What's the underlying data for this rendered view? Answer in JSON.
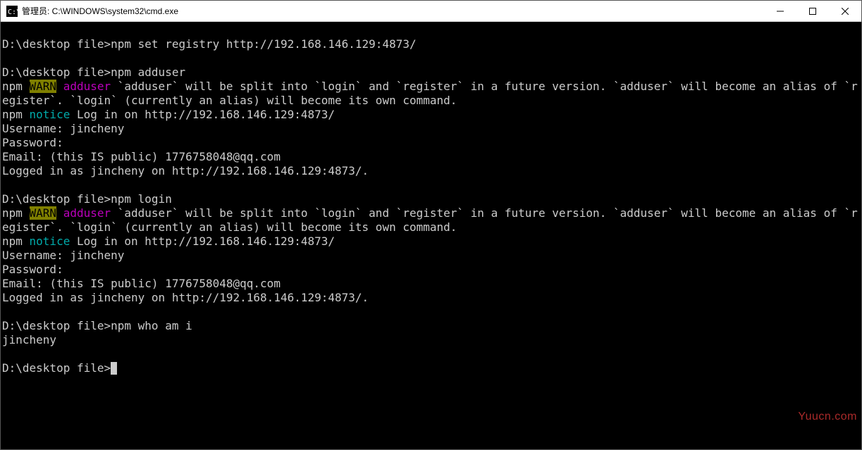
{
  "window": {
    "title": "管理员: C:\\WINDOWS\\system32\\cmd.exe"
  },
  "terminal": {
    "prompt": "D:\\desktop file>",
    "cmd_set_registry": "npm set registry http://192.168.146.129:4873/",
    "cmd_adduser": "npm adduser",
    "cmd_login": "npm login",
    "cmd_whoami": "npm who am i",
    "npm_label": "npm ",
    "warn_label": "WARN",
    "adduser_label": " adduser",
    "adduser_msg_line1": " `adduser` will be split into `login` and `register` in a future version. `adduser` will become an alias of `register`. `login` (currently an alias) will become its own command.",
    "notice_label": "notice",
    "login_url_line": " Log in on http://192.168.146.129:4873/",
    "username_line": "Username: jincheny",
    "password_line": "Password:",
    "email_line": "Email: (this IS public) 1776758048@qq.com",
    "logged_in_line": "Logged in as jincheny on http://192.168.146.129:4873/.",
    "whoami_result": "jincheny"
  },
  "watermark": "Yuucn.com"
}
